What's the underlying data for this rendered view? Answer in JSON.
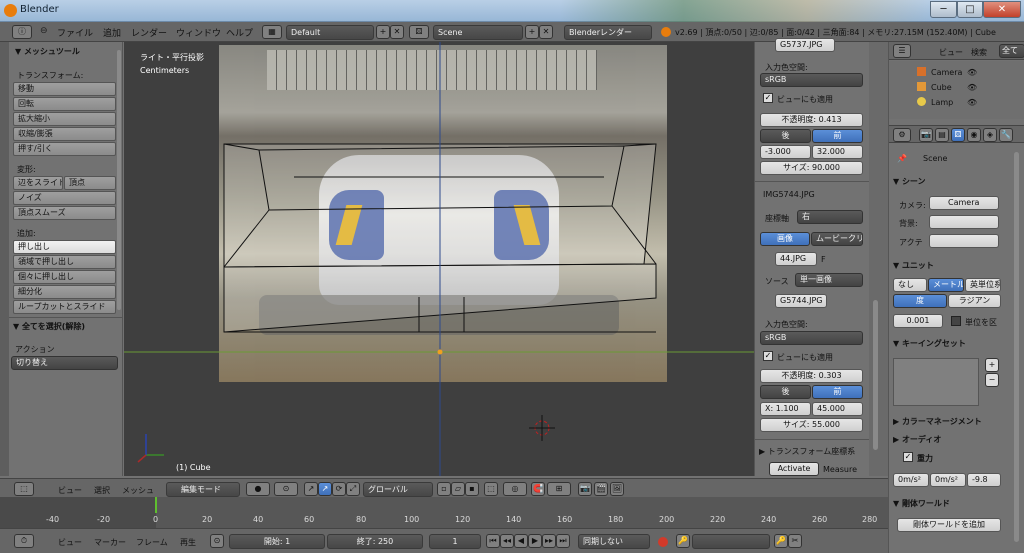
{
  "window": {
    "title": "Blender",
    "minimize": "─",
    "maximize": "□",
    "close": "✕"
  },
  "header": {
    "menus": [
      "ファイル",
      "追加",
      "レンダー",
      "ウィンドウ",
      "ヘルプ"
    ],
    "layout": "Default",
    "scene": "Scene",
    "engine": "Blenderレンダー",
    "stats": "v2.69 | 頂点:0/50 | 辺:0/85 | 面:0/42 | 三角面:84 | メモリ:27.15M (152.40M) | Cube"
  },
  "tools": {
    "title": "▼ メッシュツール",
    "transform_label": "トランスフォーム:",
    "transform": [
      "移動",
      "回転",
      "拡大縮小",
      "収縮/膨張",
      "押す/引く"
    ],
    "deform_label": "変形:",
    "deform": [
      "辺をスライド",
      "頂点",
      "ノイズ",
      "頂点スムーズ"
    ],
    "add_label": "追加:",
    "add": [
      "押し出し",
      "領域で押し出し",
      "個々に押し出し",
      "細分化",
      "ループカットとスライド"
    ],
    "select_all": "▼ 全てを選択(解除)",
    "action_label": "アクション",
    "action_value": "切り替え"
  },
  "viewport": {
    "view_label": "ライト・平行投影",
    "units": "Centimeters",
    "object_label": "(1) Cube"
  },
  "props": {
    "top_image": "G5737.JPG",
    "colorspace_label": "入力色空間:",
    "colorspace1": "sRGB",
    "view_apply1": "ビューにも適用",
    "opacity1": "不透明度: 0.413",
    "back1": "後",
    "front1": "前",
    "x1": "-3.000",
    "y1": "32.000",
    "size1": "サイズ: 90.000",
    "img2_header": "IMG5744.JPG",
    "axis_label": "座標軸",
    "axis_value": "右",
    "tab_image": "画像",
    "tab_movie": "ムービークリ",
    "file2": "44.JPG",
    "f_label": "F",
    "source_label": "ソース",
    "source_value": "単一画像",
    "file3": "G5744.JPG",
    "colorspace_label2": "入力色空間:",
    "colorspace2": "sRGB",
    "view_apply2": "ビューにも適用",
    "opacity2": "不透明度: 0.303",
    "back2": "後",
    "front2": "前",
    "x2": "X: 1.100",
    "y2": "45.000",
    "size2": "サイズ: 55.000",
    "transform_panel": "▶ トランスフォーム座標系",
    "activate": "Activate",
    "measure": "Measure"
  },
  "outliner": {
    "view": "ビュー",
    "search": "検索",
    "all": "全て",
    "items": [
      "Camera",
      "Cube",
      "Lamp"
    ]
  },
  "scene_props": {
    "scene_name": "Scene",
    "scene_panel": "▼ シーン",
    "camera_label": "カメラ:",
    "camera_value": "Camera",
    "bg_label": "背景:",
    "active_label": "アクテ",
    "units_panel": "▼ ユニット",
    "unit_none": "なし",
    "unit_metric": "メートル",
    "unit_imperial": "英単位系",
    "deg": "度",
    "rad": "ラジアン",
    "scale": "0.001",
    "separate": "単位を区",
    "keying_panel": "▼ キーイングセット",
    "color_panel": "▶ カラーマネージメント",
    "audio_panel": "▶ オーディオ",
    "gravity_panel": "重力",
    "gx": "0m/s²",
    "gy": "0m/s²",
    "gz": "-9.8",
    "rigid_panel": "▼ 剛体ワールド",
    "add_rigid": "剛体ワールドを追加"
  },
  "viewport_header": {
    "view": "ビュー",
    "select": "選択",
    "mesh": "メッシュ",
    "mode": "編集モード",
    "orientation": "グローバル"
  },
  "timeline": {
    "ticks": [
      "-40",
      "-20",
      "0",
      "20",
      "40",
      "60",
      "80",
      "100",
      "120",
      "140",
      "160",
      "180",
      "200",
      "220",
      "240",
      "260",
      "280"
    ]
  },
  "timeline_header": {
    "view": "ビュー",
    "marker": "マーカー",
    "frame": "フレーム",
    "playback": "再生",
    "start": "開始: 1",
    "end": "終了: 250",
    "current": "1",
    "sync": "同期しない"
  }
}
